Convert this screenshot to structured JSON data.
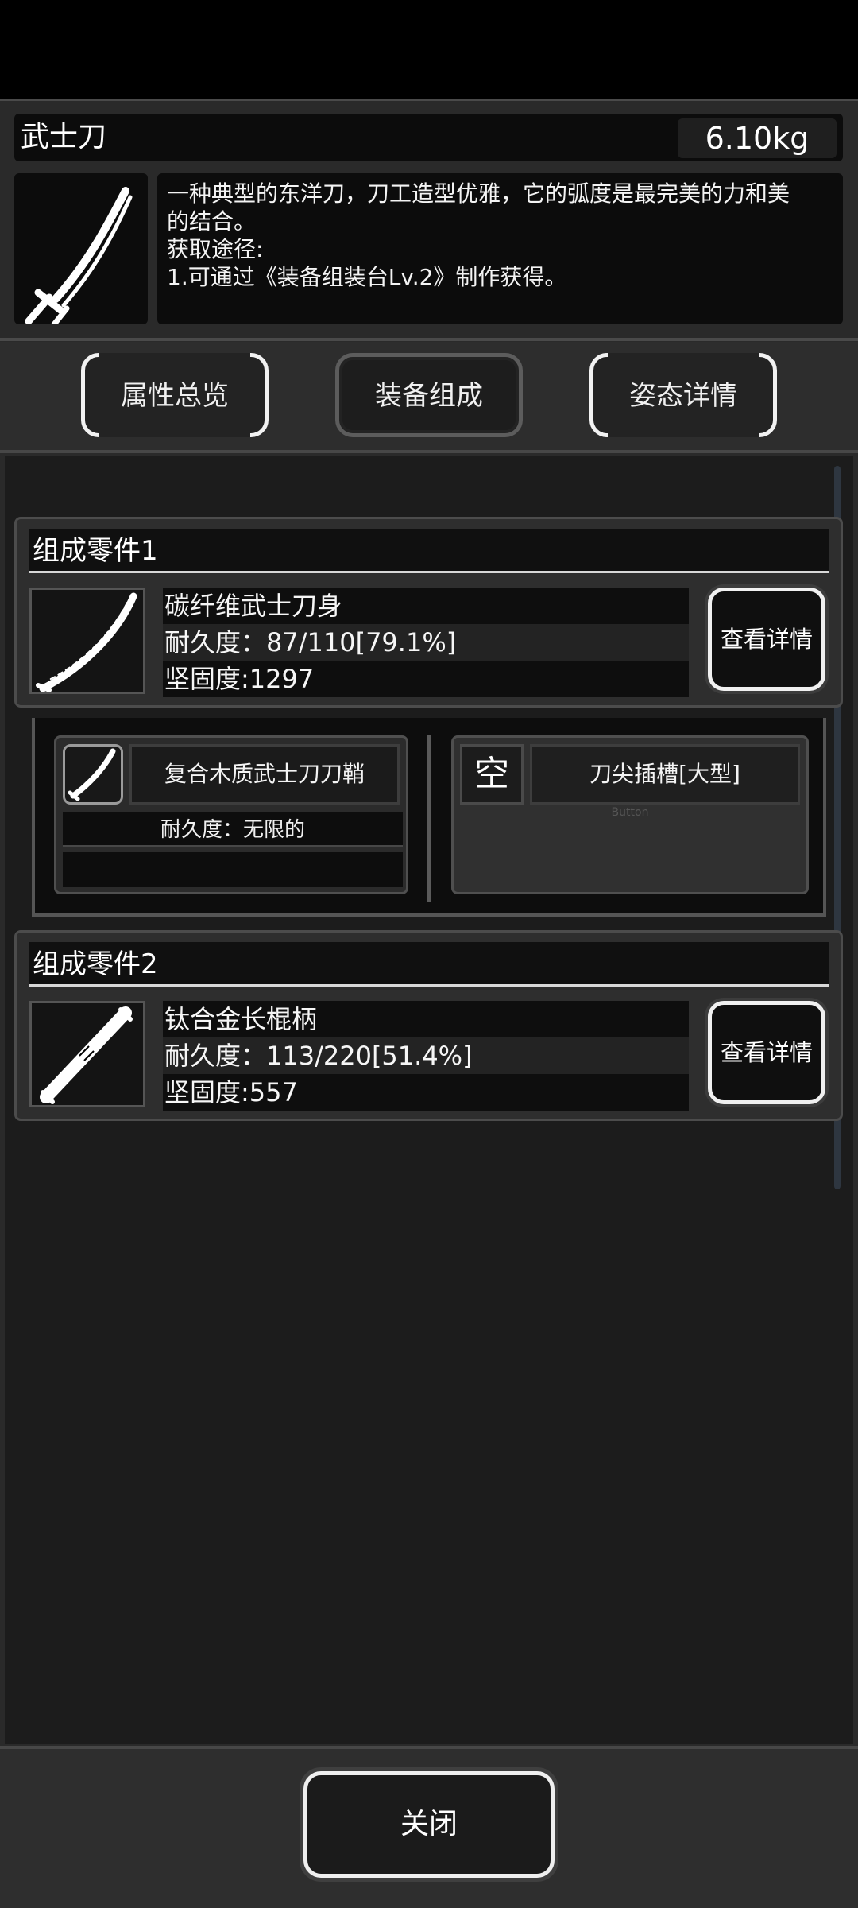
{
  "item": {
    "name": "武士刀",
    "weight": "6.10kg",
    "description": [
      "一种典型的东洋刀，刀工造型优雅，它的弧度是最完美的力和美",
      "的结合。",
      "获取途径:",
      "1.可通过《装备组装台Lv.2》制作获得。"
    ]
  },
  "tabs": [
    {
      "label": "属性总览"
    },
    {
      "label": "装备组成"
    },
    {
      "label": "姿态详情"
    }
  ],
  "parts": [
    {
      "header": "组成零件1",
      "name": "碳纤维武士刀身",
      "durability": "耐久度：87/110[79.1%]",
      "hardness": "坚固度:1297",
      "detail_label": "查看详情"
    },
    {
      "header": "组成零件2",
      "name": "钛合金长棍柄",
      "durability": "耐久度：113/220[51.4%]",
      "hardness": "坚固度:557",
      "detail_label": "查看详情"
    }
  ],
  "slots": {
    "a": {
      "name": "复合木质武士刀刀鞘",
      "durability": "耐久度：无限的"
    },
    "b": {
      "empty_label": "空",
      "name": "刀尖插槽[大型]",
      "ghost": "Button"
    }
  },
  "footer": {
    "close_label": "关闭"
  },
  "icons": {
    "item": "katana-icon",
    "part1": "blade-icon",
    "part2": "handle-icon",
    "slotA": "scabbard-icon"
  }
}
